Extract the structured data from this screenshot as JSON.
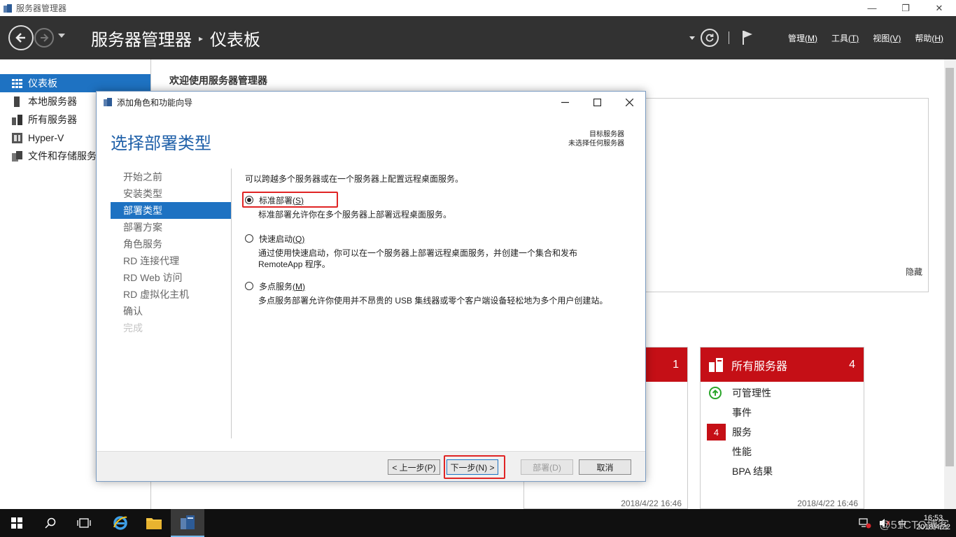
{
  "window": {
    "title": "服务器管理器",
    "minimize": "—",
    "restore": "❐",
    "close": "✕"
  },
  "header": {
    "breadcrumb_app": "服务器管理器",
    "breadcrumb_sep": "▸",
    "breadcrumb_page": "仪表板",
    "menus": [
      {
        "label": "管理",
        "key": "(M)"
      },
      {
        "label": "工具",
        "key": "(T)"
      },
      {
        "label": "视图",
        "key": "(V)"
      },
      {
        "label": "帮助",
        "key": "(H)"
      }
    ]
  },
  "sidebar": {
    "items": [
      {
        "label": "仪表板",
        "icon": "dashboard-icon"
      },
      {
        "label": "本地服务器",
        "icon": "server-icon"
      },
      {
        "label": "所有服务器",
        "icon": "servers-icon"
      },
      {
        "label": "Hyper-V",
        "icon": "hyperv-icon"
      },
      {
        "label": "文件和存储服务",
        "icon": "storage-icon"
      }
    ]
  },
  "main": {
    "welcome": "欢迎使用服务器管理器",
    "hide": "隐藏",
    "tile_a": {
      "count": "1",
      "date": "2018/4/22 16:46"
    },
    "tile_b": {
      "title": "所有服务器",
      "count": "4",
      "rows": [
        "可管理性",
        "事件",
        "服务",
        "性能",
        "BPA 结果"
      ],
      "services_badge": "4",
      "date": "2018/4/22 16:46"
    }
  },
  "dialog": {
    "title": "添加角色和功能向导",
    "heading": "选择部署类型",
    "target_label": "目标服务器",
    "target_value": "未选择任何服务器",
    "steps": [
      "开始之前",
      "安装类型",
      "部署类型",
      "部署方案",
      "角色服务",
      "RD 连接代理",
      "RD Web 访问",
      "RD 虚拟化主机",
      "确认",
      "完成"
    ],
    "active_step": 2,
    "intro": "可以跨越多个服务器或在一个服务器上配置远程桌面服务。",
    "options": [
      {
        "label": "标准部署",
        "key": "(S)",
        "desc": "标准部署允许你在多个服务器上部署远程桌面服务。",
        "checked": true
      },
      {
        "label": "快速启动",
        "key": "(Q)",
        "desc": "通过使用快速启动，你可以在一个服务器上部署远程桌面服务，并创建一个集合和发布 RemoteApp 程序。",
        "checked": false
      },
      {
        "label": "多点服务",
        "key": "(M)",
        "desc": "多点服务部署允许你使用并不昂贵的 USB 集线器或零个客户端设备轻松地为多个用户创建站。",
        "checked": false
      }
    ],
    "buttons": {
      "prev": "< 上一步(P)",
      "next": "下一步(N) >",
      "deploy": "部署(D)",
      "cancel": "取消"
    }
  },
  "taskbar": {
    "ime": "中",
    "time": "16:53",
    "date": "2018/4/22",
    "watermark": "@51CTO博客"
  },
  "colors": {
    "accent": "#1e72c2",
    "header_bg": "#323232",
    "alert_red": "#c50f16",
    "highlight_red": "#e02424",
    "heading_blue": "#1e5fa8"
  }
}
